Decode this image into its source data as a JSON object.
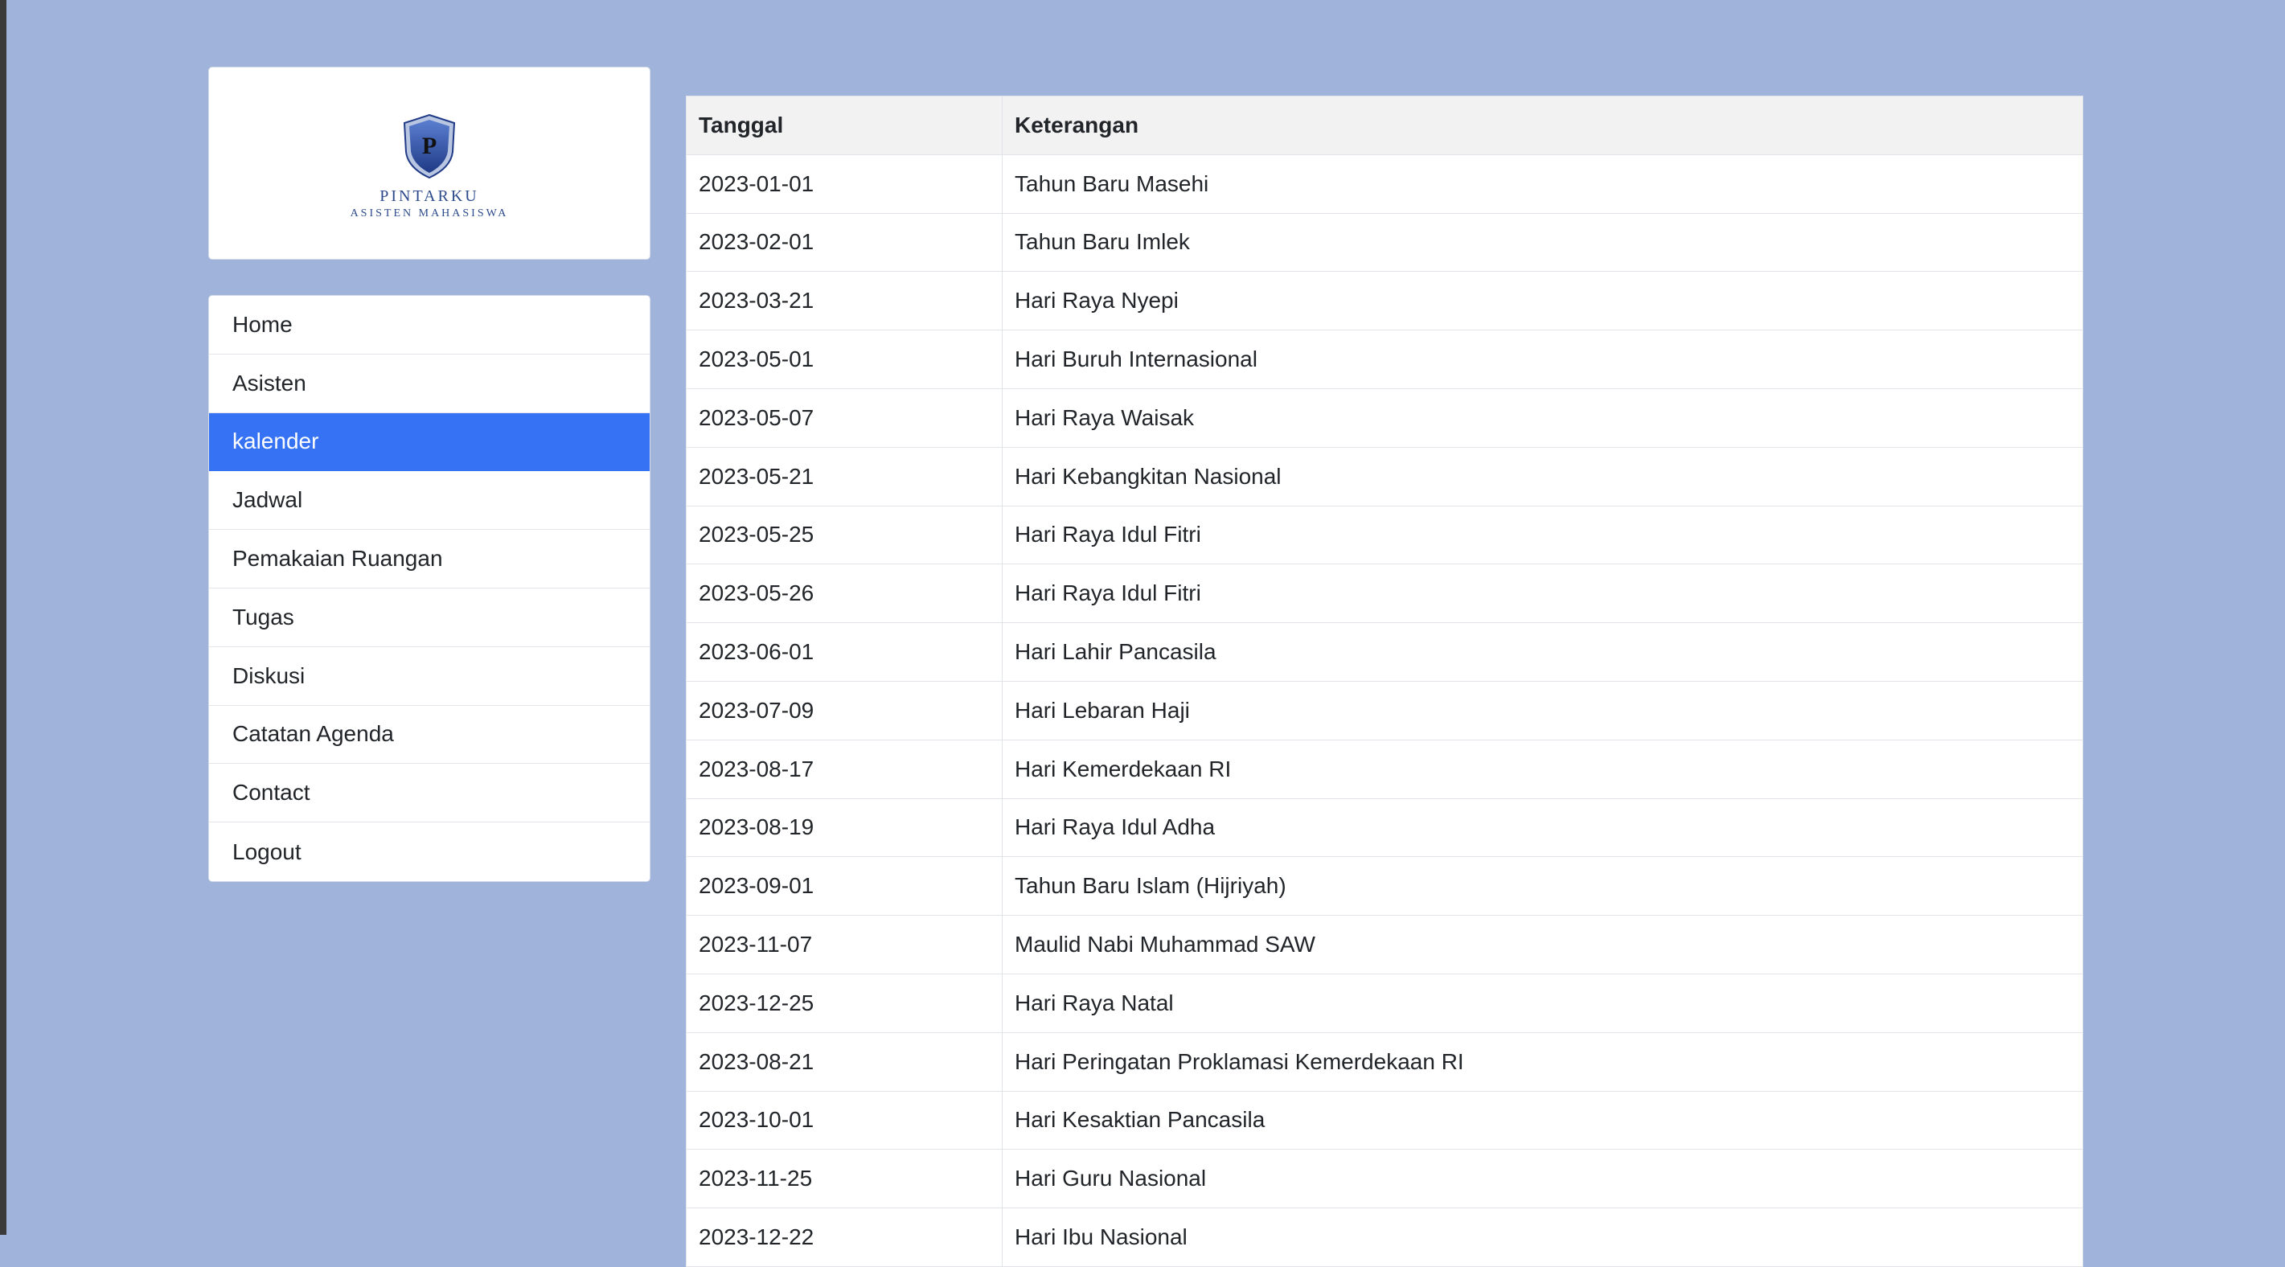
{
  "brand": {
    "initial": "P",
    "name": "PINTARKU",
    "tagline": "ASISTEN MAHASISWA"
  },
  "nav": {
    "items": [
      {
        "label": "Home",
        "active": false
      },
      {
        "label": "Asisten",
        "active": false
      },
      {
        "label": "kalender",
        "active": true
      },
      {
        "label": "Jadwal",
        "active": false
      },
      {
        "label": "Pemakaian Ruangan",
        "active": false
      },
      {
        "label": "Tugas",
        "active": false
      },
      {
        "label": "Diskusi",
        "active": false
      },
      {
        "label": "Catatan Agenda",
        "active": false
      },
      {
        "label": "Contact",
        "active": false
      },
      {
        "label": "Logout",
        "active": false
      }
    ]
  },
  "table": {
    "headers": [
      "Tanggal",
      "Keterangan"
    ],
    "rows": [
      [
        "2023-01-01",
        "Tahun Baru Masehi"
      ],
      [
        "2023-02-01",
        "Tahun Baru Imlek"
      ],
      [
        "2023-03-21",
        "Hari Raya Nyepi"
      ],
      [
        "2023-05-01",
        "Hari Buruh Internasional"
      ],
      [
        "2023-05-07",
        "Hari Raya Waisak"
      ],
      [
        "2023-05-21",
        "Hari Kebangkitan Nasional"
      ],
      [
        "2023-05-25",
        "Hari Raya Idul Fitri"
      ],
      [
        "2023-05-26",
        "Hari Raya Idul Fitri"
      ],
      [
        "2023-06-01",
        "Hari Lahir Pancasila"
      ],
      [
        "2023-07-09",
        "Hari Lebaran Haji"
      ],
      [
        "2023-08-17",
        "Hari Kemerdekaan RI"
      ],
      [
        "2023-08-19",
        "Hari Raya Idul Adha"
      ],
      [
        "2023-09-01",
        "Tahun Baru Islam (Hijriyah)"
      ],
      [
        "2023-11-07",
        "Maulid Nabi Muhammad SAW"
      ],
      [
        "2023-12-25",
        "Hari Raya Natal"
      ],
      [
        "2023-08-21",
        "Hari Peringatan Proklamasi Kemerdekaan RI"
      ],
      [
        "2023-10-01",
        "Hari Kesaktian Pancasila"
      ],
      [
        "2023-11-25",
        "Hari Guru Nasional"
      ],
      [
        "2023-12-22",
        "Hari Ibu Nasional"
      ]
    ]
  },
  "colors": {
    "page_bg": "#9fb3db",
    "active_nav": "#3673f4",
    "header_bg": "#f2f2f2",
    "brand_blue": "#2c4a8c"
  }
}
